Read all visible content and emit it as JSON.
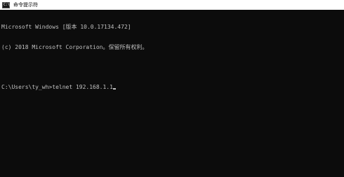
{
  "window": {
    "title": "命令提示符",
    "icon": "cmd-icon",
    "icon_glyph": "C:\\"
  },
  "console": {
    "lines": [
      "Microsoft Windows [版本 10.0.17134.472]",
      "(c) 2018 Microsoft Corporation。保留所有权利。",
      "",
      "C:\\Users\\ty_wh>telnet 192.168.1.1"
    ]
  },
  "colors": {
    "background": "#0c0c0c",
    "text": "#c0c0c0",
    "titlebar": "#ffffff"
  }
}
